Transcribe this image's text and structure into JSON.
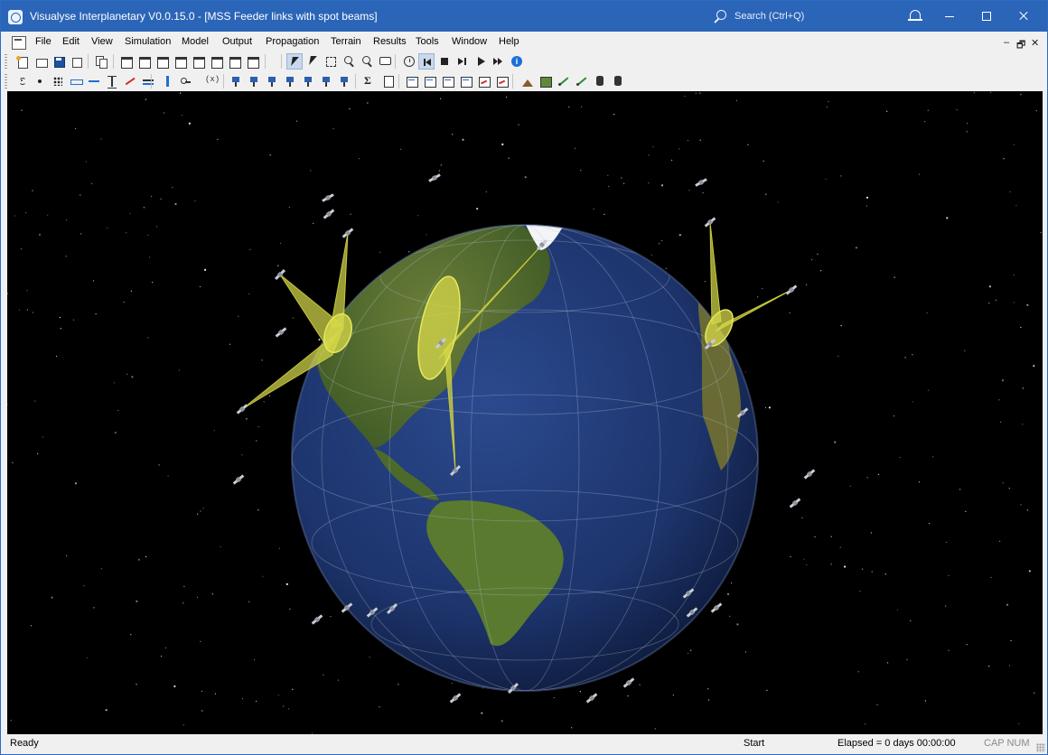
{
  "window": {
    "title": "Visualyse Interplanetary V0.0.15.0 - [MSS Feeder links with spot beams]",
    "search_label": "Search (Ctrl+Q)",
    "icons": [
      "app-icon",
      "search-icon",
      "bell-icon",
      "minimize-icon",
      "maximize-icon",
      "close-icon"
    ]
  },
  "menu": {
    "items": [
      "File",
      "Edit",
      "View",
      "Simulation",
      "Model",
      "Output",
      "Propagation",
      "Terrain",
      "Results",
      "Tools",
      "Window",
      "Help"
    ],
    "mdi_controls": [
      "–",
      "🗗",
      "✕"
    ]
  },
  "toolbar1": [
    {
      "name": "new-icon",
      "icon": "new"
    },
    {
      "name": "open-icon",
      "icon": "open"
    },
    {
      "name": "save-icon",
      "icon": "save"
    },
    {
      "name": "save-as-icon",
      "icon": "saveas"
    },
    {
      "name": "copy-icon",
      "icon": "copy"
    },
    {
      "name": "view-window-1-icon",
      "icon": "window"
    },
    {
      "name": "view-window-2-icon",
      "icon": "window"
    },
    {
      "name": "view-window-3-icon",
      "icon": "window"
    },
    {
      "name": "view-window-4-icon",
      "icon": "window"
    },
    {
      "name": "view-window-5-icon",
      "icon": "window"
    },
    {
      "name": "view-window-6-icon",
      "icon": "window"
    },
    {
      "name": "view-window-7-icon",
      "icon": "window"
    },
    {
      "name": "view-window-8-icon",
      "icon": "window"
    },
    {
      "name": "select-arrow-icon",
      "icon": "arrow",
      "active": true
    },
    {
      "name": "select-plus-icon",
      "icon": "arrow"
    },
    {
      "name": "select-rect-icon",
      "icon": "rect"
    },
    {
      "name": "zoom-in-icon",
      "icon": "zoomin"
    },
    {
      "name": "zoom-out-icon",
      "icon": "zoomout"
    },
    {
      "name": "annotate-icon",
      "icon": "bubble"
    },
    {
      "name": "clock-icon",
      "icon": "clock"
    },
    {
      "name": "rewind-icon",
      "icon": "rewind",
      "active": true
    },
    {
      "name": "stop-icon",
      "icon": "stop"
    },
    {
      "name": "step-icon",
      "icon": "step"
    },
    {
      "name": "play-icon",
      "icon": "play"
    },
    {
      "name": "fast-forward-icon",
      "icon": "ff"
    },
    {
      "name": "info-icon",
      "icon": "info"
    }
  ],
  "toolbar2": [
    {
      "name": "antenna-icon",
      "icon": "antenna"
    },
    {
      "name": "point-icon",
      "icon": "dot"
    },
    {
      "name": "points-icon",
      "icon": "dots"
    },
    {
      "name": "area-icon",
      "icon": "bar"
    },
    {
      "name": "link-icon",
      "icon": "linkarrow"
    },
    {
      "name": "range-icon",
      "icon": "range"
    },
    {
      "name": "beam-icon",
      "icon": "beam"
    },
    {
      "name": "transfer-icon",
      "icon": "transfer"
    },
    {
      "name": "sort-icon",
      "icon": "updown"
    },
    {
      "name": "group-icon",
      "icon": "group"
    },
    {
      "name": "variable-icon",
      "icon": "var"
    },
    {
      "name": "station-1-icon",
      "icon": "station"
    },
    {
      "name": "station-2-icon",
      "icon": "station"
    },
    {
      "name": "station-3-icon",
      "icon": "station"
    },
    {
      "name": "station-4-icon",
      "icon": "station"
    },
    {
      "name": "station-5-icon",
      "icon": "station"
    },
    {
      "name": "station-6-icon",
      "icon": "station"
    },
    {
      "name": "station-7-icon",
      "icon": "station"
    },
    {
      "name": "sum-icon",
      "icon": "sigma"
    },
    {
      "name": "export-icon",
      "icon": "doc"
    },
    {
      "name": "report-1-icon",
      "icon": "report"
    },
    {
      "name": "report-2-icon",
      "icon": "report"
    },
    {
      "name": "report-3-icon",
      "icon": "report"
    },
    {
      "name": "report-4-icon",
      "icon": "report"
    },
    {
      "name": "report-5-icon",
      "icon": "chart"
    },
    {
      "name": "report-6-icon",
      "icon": "chart"
    },
    {
      "name": "terrain-icon",
      "icon": "terrain"
    },
    {
      "name": "map-icon",
      "icon": "map"
    },
    {
      "name": "route-icon",
      "icon": "route"
    },
    {
      "name": "path-icon",
      "icon": "route"
    },
    {
      "name": "db-icon",
      "icon": "db"
    },
    {
      "name": "db-down-icon",
      "icon": "db"
    }
  ],
  "status": {
    "ready": "Ready",
    "start": "Start",
    "elapsed": "Elapsed = 0 days 00:00:00",
    "caps": "CAP NUM"
  },
  "scene": {
    "background": "#000000",
    "beam_color": "#d6d84a",
    "ocean_color": "#203a78",
    "land_color": "#4f6a2c"
  }
}
